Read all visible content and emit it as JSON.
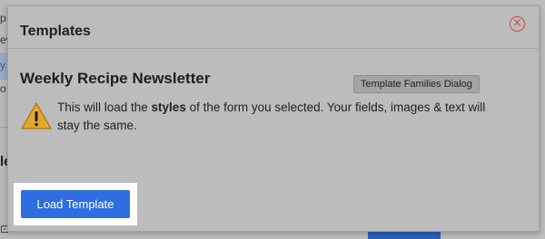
{
  "background": {
    "left_fragments": [
      "p",
      "ev",
      "y",
      "o"
    ],
    "side_heading_glyph": "le",
    "bottom_glyph": "⊡"
  },
  "modal": {
    "title": "Templates",
    "close_icon": "close-circle-icon",
    "template_name": "Weekly Recipe Newsletter",
    "tooltip": "Template Families Dialog",
    "warning_icon": "warning-triangle-icon",
    "message_before": "This will load the ",
    "message_bold": "styles",
    "message_after": " of the form you selected. Your fields, images & text will stay the same.",
    "load_button_label": "Load Template"
  },
  "colors": {
    "accent": "#2f6ee0",
    "close": "#c4504b",
    "warning_fill": "#e0a92e"
  }
}
